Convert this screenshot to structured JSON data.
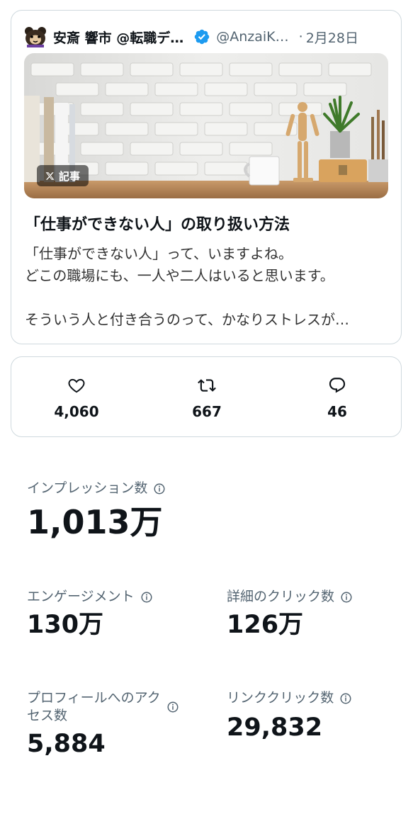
{
  "post": {
    "author": "安斎 響市 @転職デ…",
    "handle": "@AnzaiK…",
    "date": "2月28日",
    "dot": "·",
    "badge_label": "記事",
    "article_title": "「仕事ができない人」の取り扱い方法",
    "article_lines": [
      "「仕事ができない人」って、いますよね。",
      "どこの職場にも、一人や二人はいると思います。",
      "",
      "そういう人と付き合うのって、かなりストレスが…"
    ]
  },
  "engagement": {
    "likes": "4,060",
    "reposts": "667",
    "replies": "46"
  },
  "metrics": {
    "impressions_label": "インプレッション数",
    "impressions_value": "1,013万",
    "engagements_label": "エンゲージメント",
    "engagements_value": "130万",
    "detail_clicks_label": "詳細のクリック数",
    "detail_clicks_value": "126万",
    "profile_access_label_1": "プロフィールへのアク",
    "profile_access_label_2": "セス数",
    "profile_access_value": "5,884",
    "link_clicks_label": "リンククリック数",
    "link_clicks_value": "29,832"
  },
  "colors": {
    "verified": "#1d9bf0",
    "secondary_text": "#536471",
    "border": "#cfd9de"
  },
  "icons": [
    "bear-avatar-icon",
    "verified-badge-icon",
    "x-logo-icon",
    "heart-icon",
    "repost-icon",
    "reply-icon",
    "info-icon"
  ]
}
